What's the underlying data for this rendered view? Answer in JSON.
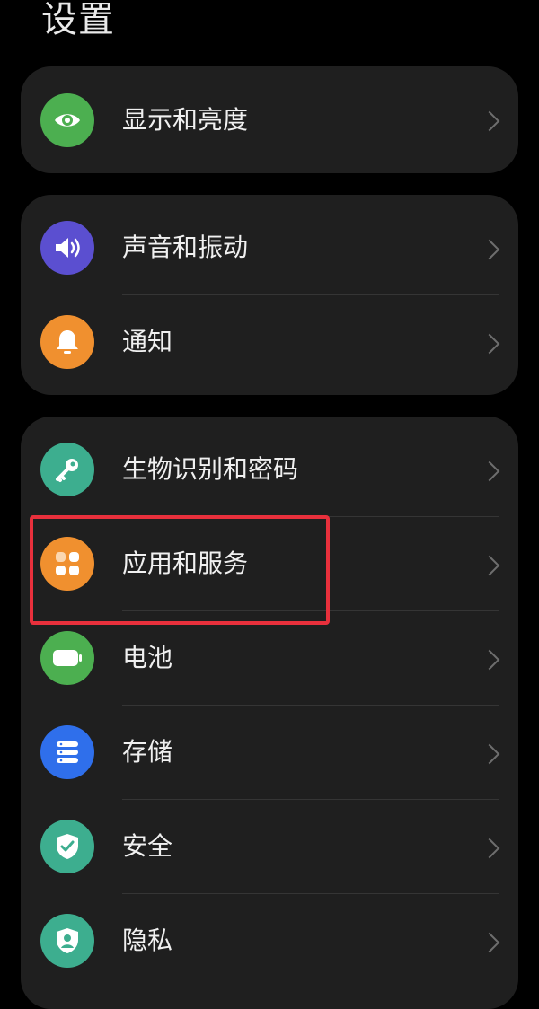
{
  "page": {
    "title": "设置"
  },
  "groups": [
    {
      "items": [
        {
          "label": "显示和亮度",
          "icon": "eye-icon",
          "color": "#4CAF50"
        }
      ]
    },
    {
      "items": [
        {
          "label": "声音和振动",
          "icon": "speaker-icon",
          "color": "#5B4FD0"
        },
        {
          "label": "通知",
          "icon": "bell-icon",
          "color": "#F0902F"
        }
      ]
    },
    {
      "items": [
        {
          "label": "生物识别和密码",
          "icon": "key-icon",
          "color": "#3DAE8F"
        },
        {
          "label": "应用和服务",
          "icon": "apps-icon",
          "color": "#F0902F"
        },
        {
          "label": "电池",
          "icon": "battery-icon",
          "color": "#4CAF50"
        },
        {
          "label": "存储",
          "icon": "storage-icon",
          "color": "#2F6FEB"
        },
        {
          "label": "安全",
          "icon": "shield-check-icon",
          "color": "#3DAE8F"
        },
        {
          "label": "隐私",
          "icon": "privacy-shield-icon",
          "color": "#3DAE8F"
        }
      ]
    }
  ],
  "highlight": {
    "color": "#e8303c",
    "target": "应用和服务"
  }
}
